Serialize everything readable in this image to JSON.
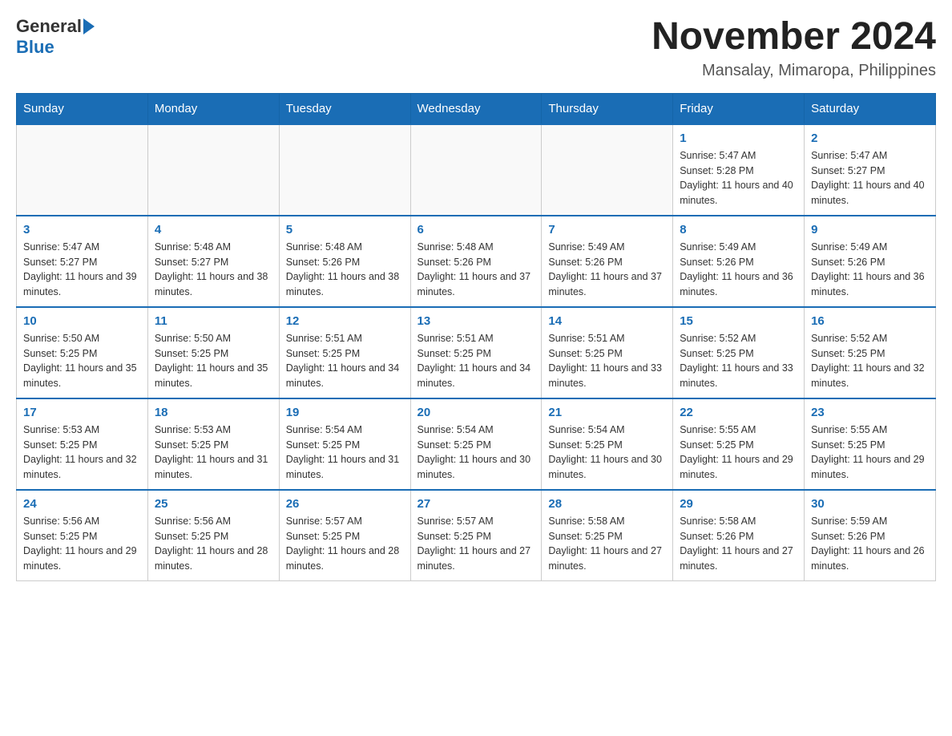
{
  "header": {
    "logo": {
      "general": "General",
      "blue": "Blue"
    },
    "title": "November 2024",
    "location": "Mansalay, Mimaropa, Philippines"
  },
  "days_of_week": [
    "Sunday",
    "Monday",
    "Tuesday",
    "Wednesday",
    "Thursday",
    "Friday",
    "Saturday"
  ],
  "weeks": [
    [
      {
        "day": "",
        "info": ""
      },
      {
        "day": "",
        "info": ""
      },
      {
        "day": "",
        "info": ""
      },
      {
        "day": "",
        "info": ""
      },
      {
        "day": "",
        "info": ""
      },
      {
        "day": "1",
        "info": "Sunrise: 5:47 AM\nSunset: 5:28 PM\nDaylight: 11 hours and 40 minutes."
      },
      {
        "day": "2",
        "info": "Sunrise: 5:47 AM\nSunset: 5:27 PM\nDaylight: 11 hours and 40 minutes."
      }
    ],
    [
      {
        "day": "3",
        "info": "Sunrise: 5:47 AM\nSunset: 5:27 PM\nDaylight: 11 hours and 39 minutes."
      },
      {
        "day": "4",
        "info": "Sunrise: 5:48 AM\nSunset: 5:27 PM\nDaylight: 11 hours and 38 minutes."
      },
      {
        "day": "5",
        "info": "Sunrise: 5:48 AM\nSunset: 5:26 PM\nDaylight: 11 hours and 38 minutes."
      },
      {
        "day": "6",
        "info": "Sunrise: 5:48 AM\nSunset: 5:26 PM\nDaylight: 11 hours and 37 minutes."
      },
      {
        "day": "7",
        "info": "Sunrise: 5:49 AM\nSunset: 5:26 PM\nDaylight: 11 hours and 37 minutes."
      },
      {
        "day": "8",
        "info": "Sunrise: 5:49 AM\nSunset: 5:26 PM\nDaylight: 11 hours and 36 minutes."
      },
      {
        "day": "9",
        "info": "Sunrise: 5:49 AM\nSunset: 5:26 PM\nDaylight: 11 hours and 36 minutes."
      }
    ],
    [
      {
        "day": "10",
        "info": "Sunrise: 5:50 AM\nSunset: 5:25 PM\nDaylight: 11 hours and 35 minutes."
      },
      {
        "day": "11",
        "info": "Sunrise: 5:50 AM\nSunset: 5:25 PM\nDaylight: 11 hours and 35 minutes."
      },
      {
        "day": "12",
        "info": "Sunrise: 5:51 AM\nSunset: 5:25 PM\nDaylight: 11 hours and 34 minutes."
      },
      {
        "day": "13",
        "info": "Sunrise: 5:51 AM\nSunset: 5:25 PM\nDaylight: 11 hours and 34 minutes."
      },
      {
        "day": "14",
        "info": "Sunrise: 5:51 AM\nSunset: 5:25 PM\nDaylight: 11 hours and 33 minutes."
      },
      {
        "day": "15",
        "info": "Sunrise: 5:52 AM\nSunset: 5:25 PM\nDaylight: 11 hours and 33 minutes."
      },
      {
        "day": "16",
        "info": "Sunrise: 5:52 AM\nSunset: 5:25 PM\nDaylight: 11 hours and 32 minutes."
      }
    ],
    [
      {
        "day": "17",
        "info": "Sunrise: 5:53 AM\nSunset: 5:25 PM\nDaylight: 11 hours and 32 minutes."
      },
      {
        "day": "18",
        "info": "Sunrise: 5:53 AM\nSunset: 5:25 PM\nDaylight: 11 hours and 31 minutes."
      },
      {
        "day": "19",
        "info": "Sunrise: 5:54 AM\nSunset: 5:25 PM\nDaylight: 11 hours and 31 minutes."
      },
      {
        "day": "20",
        "info": "Sunrise: 5:54 AM\nSunset: 5:25 PM\nDaylight: 11 hours and 30 minutes."
      },
      {
        "day": "21",
        "info": "Sunrise: 5:54 AM\nSunset: 5:25 PM\nDaylight: 11 hours and 30 minutes."
      },
      {
        "day": "22",
        "info": "Sunrise: 5:55 AM\nSunset: 5:25 PM\nDaylight: 11 hours and 29 minutes."
      },
      {
        "day": "23",
        "info": "Sunrise: 5:55 AM\nSunset: 5:25 PM\nDaylight: 11 hours and 29 minutes."
      }
    ],
    [
      {
        "day": "24",
        "info": "Sunrise: 5:56 AM\nSunset: 5:25 PM\nDaylight: 11 hours and 29 minutes."
      },
      {
        "day": "25",
        "info": "Sunrise: 5:56 AM\nSunset: 5:25 PM\nDaylight: 11 hours and 28 minutes."
      },
      {
        "day": "26",
        "info": "Sunrise: 5:57 AM\nSunset: 5:25 PM\nDaylight: 11 hours and 28 minutes."
      },
      {
        "day": "27",
        "info": "Sunrise: 5:57 AM\nSunset: 5:25 PM\nDaylight: 11 hours and 27 minutes."
      },
      {
        "day": "28",
        "info": "Sunrise: 5:58 AM\nSunset: 5:25 PM\nDaylight: 11 hours and 27 minutes."
      },
      {
        "day": "29",
        "info": "Sunrise: 5:58 AM\nSunset: 5:26 PM\nDaylight: 11 hours and 27 minutes."
      },
      {
        "day": "30",
        "info": "Sunrise: 5:59 AM\nSunset: 5:26 PM\nDaylight: 11 hours and 26 minutes."
      }
    ]
  ]
}
